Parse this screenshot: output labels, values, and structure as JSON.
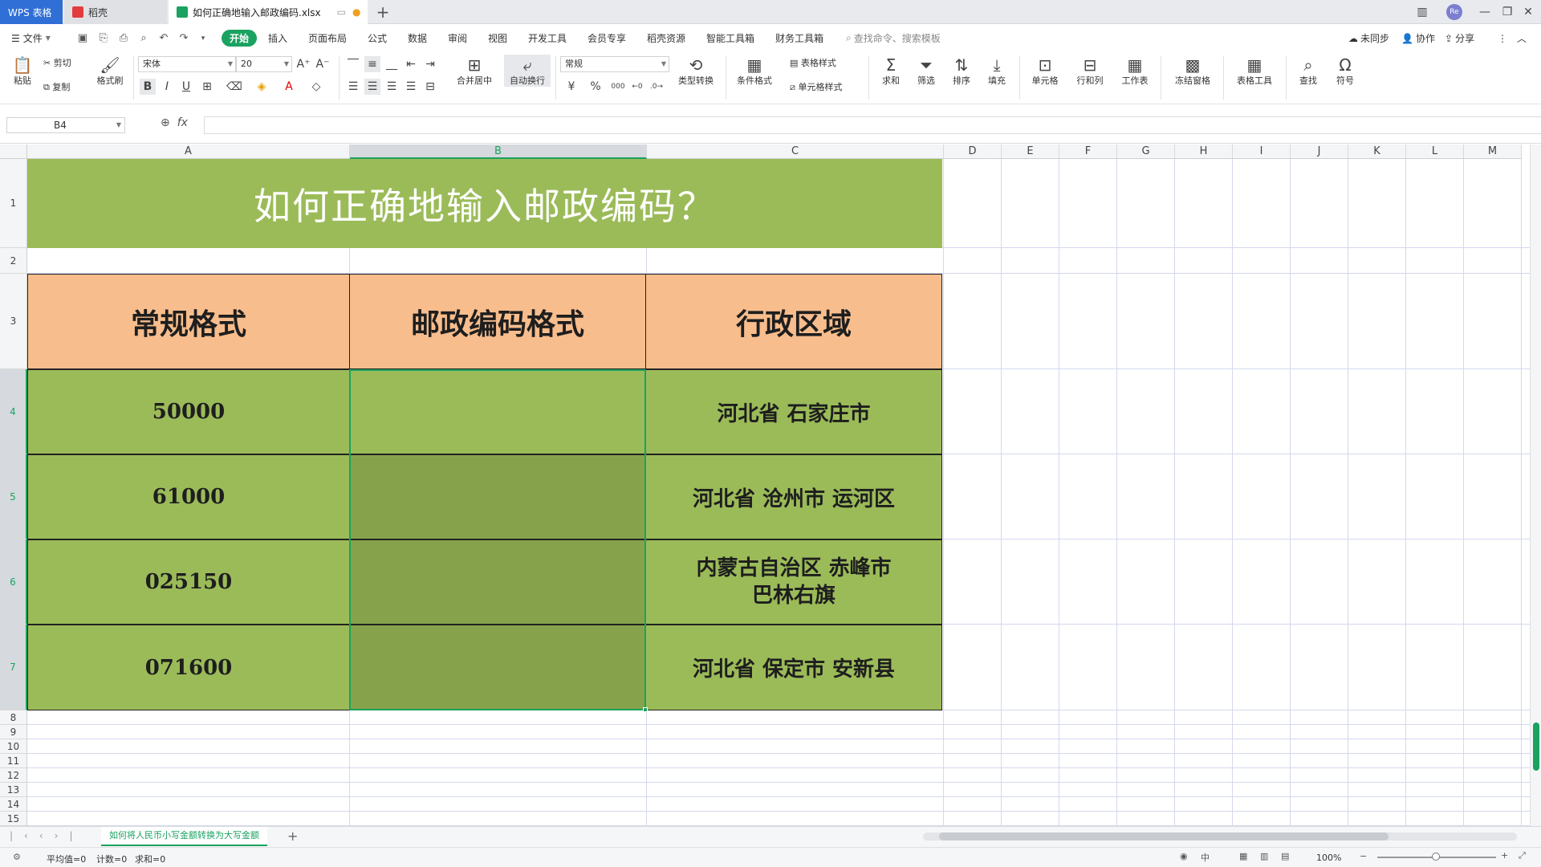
{
  "titlebar": {
    "app_tab": "WPS 表格",
    "daoke_tab": "稻壳",
    "file_tab": "如何正确地输入邮政编码.xlsx",
    "new_tab": "+",
    "avatar_text": "Re"
  },
  "menu": {
    "file": "文件",
    "items": [
      "开始",
      "插入",
      "页面布局",
      "公式",
      "数据",
      "审阅",
      "视图",
      "开发工具",
      "会员专享",
      "稻壳资源",
      "智能工具箱",
      "财务工具箱"
    ],
    "search": "查找命令、搜索模板",
    "sync": "未同步",
    "collab": "协作",
    "share": "分享"
  },
  "ribbon": {
    "paste": "粘贴",
    "cut": "剪切",
    "copy": "复制",
    "format_painter": "格式刷",
    "font_name": "宋体",
    "font_size": "20",
    "bold": "B",
    "italic": "I",
    "underline": "U",
    "merge_center": "合并居中",
    "wrap_text": "自动换行",
    "number_format": "常规",
    "currency": "¥",
    "percent": "%",
    "thousands": "000",
    "type_convert": "类型转换",
    "cond_format": "条件格式",
    "table_style": "表格样式",
    "cell_style": "单元格样式",
    "sum": "求和",
    "filter": "筛选",
    "sort": "排序",
    "fill": "填充",
    "cell": "单元格",
    "row_col": "行和列",
    "worksheet": "工作表",
    "freeze": "冻结窗格",
    "table_tools": "表格工具",
    "find": "查找",
    "symbol": "符号"
  },
  "formula_bar": {
    "name_box": "B4",
    "fx": "fx",
    "value": ""
  },
  "columns": [
    "A",
    "B",
    "C",
    "D",
    "E",
    "F",
    "G",
    "H",
    "I",
    "J",
    "K",
    "L",
    "M"
  ],
  "rows": [
    "1",
    "2",
    "3",
    "4",
    "5",
    "6",
    "7",
    "8",
    "9",
    "10",
    "11",
    "12",
    "13",
    "14",
    "15"
  ],
  "sheet": {
    "title": "如何正确地输入邮政编码？",
    "headers": [
      "常规格式",
      "邮政编码格式",
      "行政区域"
    ],
    "data": [
      {
        "code": "50000",
        "postal": "",
        "region": "河北省  石家庄市"
      },
      {
        "code": "61000",
        "postal": "",
        "region": "河北省  沧州市  运河区"
      },
      {
        "code": "025150",
        "postal": "",
        "region": "内蒙古自治区  赤峰市\n巴林右旗"
      },
      {
        "code": "071600",
        "postal": "",
        "region": "河北省  保定市  安新县"
      }
    ]
  },
  "sheet_tabs": {
    "active": "如何将人民币小写金额转换为大写金额",
    "add": "+"
  },
  "status": {
    "average": "平均值=0",
    "count": "计数=0",
    "sum": "求和=0",
    "zoom": "100%"
  },
  "colors": {
    "title_bg": "#9bbb59",
    "header_bg": "#f8bd8d",
    "data_bg": "#9bbb59",
    "selected_bg": "#86a34c",
    "accent": "#1aa260"
  }
}
